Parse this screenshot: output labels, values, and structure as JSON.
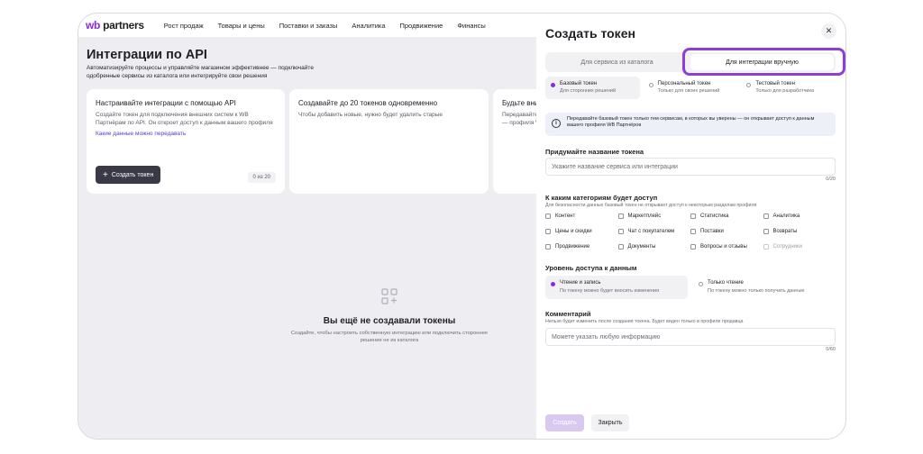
{
  "nav": {
    "logo_wb": "wb",
    "logo_partners": "partners",
    "items": [
      {
        "label": "Рост продаж"
      },
      {
        "label": "Товары и цены"
      },
      {
        "label": "Поставки и заказы"
      },
      {
        "label": "Аналитика"
      },
      {
        "label": "Продвижение"
      },
      {
        "label": "Финансы"
      }
    ]
  },
  "page": {
    "title": "Интеграции по API",
    "subtitle": "Автоматизируйте процессы и управляйте магазином эффективнее — подключайте одобренные сервисы из каталога или интегрируйте свои решения"
  },
  "cards": [
    {
      "title": "Настраивайте интеграции с помощью API",
      "text": "Создайте токен для подключения внешних систем к WB Партнёрам по API. Он откроет доступ к данным вашего профиля",
      "link": "Какие данные можно передавать",
      "button": "Создать токен",
      "counter": "0 из 20"
    },
    {
      "title": "Создавайте до 20 токенов одновременно",
      "text": "Чтобы добавить новые, нужно будет удалить старые"
    },
    {
      "title": "Будьте вни",
      "text": "Передавайте вы уверены — профиля W"
    }
  ],
  "empty": {
    "title": "Вы ещё не создавали токены",
    "text": "Создайте, чтобы настроить собственную интеграцию или подключить стороннее решение не из каталога"
  },
  "panel": {
    "title": "Создать токен",
    "close_icon": "close-icon",
    "tabs": [
      {
        "label": "Для сервиса из каталога"
      },
      {
        "label": "Для интеграции вручную"
      }
    ],
    "highlight_color": "#8f3cd8",
    "accent_color": "#8a2be2",
    "token_types": [
      {
        "label": "Базовый токен",
        "sub": "Для сторонних решений"
      },
      {
        "label": "Персональный токен",
        "sub": "Только для своих решений"
      },
      {
        "label": "Тестовый токен",
        "sub": "Только для разработчика"
      }
    ],
    "info_text": "Передавайте базовый токен только тем сервисам, в которых вы уверены — он открывает доступ к данным вашего профиля WB Партнёров",
    "name_label": "Придумайте название токена",
    "name_placeholder": "Укажите название сервиса или интеграции",
    "name_count": "0/20",
    "categories_label": "К каким категориям будет доступ",
    "categories_note": "Для безопасности данных базовый токен не открывает доступ к некоторым разделам профиля",
    "categories": [
      {
        "label": "Контент"
      },
      {
        "label": "Маркетплейс"
      },
      {
        "label": "Статистика"
      },
      {
        "label": "Аналитика"
      },
      {
        "label": "Цены и скидки"
      },
      {
        "label": "Чат с покупателем"
      },
      {
        "label": "Поставки"
      },
      {
        "label": "Возвраты"
      },
      {
        "label": "Продвижение"
      },
      {
        "label": "Документы"
      },
      {
        "label": "Вопросы и отзывы"
      },
      {
        "label": "Сотрудники"
      }
    ],
    "access_label": "Уровень доступа к данным",
    "access_levels": [
      {
        "label": "Чтение и запись",
        "sub": "По токену можно будет вносить изменения"
      },
      {
        "label": "Только чтение",
        "sub": "По токену можно только получать данные"
      }
    ],
    "comment_label": "Комментарий",
    "comment_note": "Нельзя будет изменить после создания токена. Будет виден только в профиле продавца",
    "comment_placeholder": "Можете указать любую информацию",
    "comment_count": "0/60",
    "submit": "Создать",
    "close": "Закрыть"
  }
}
